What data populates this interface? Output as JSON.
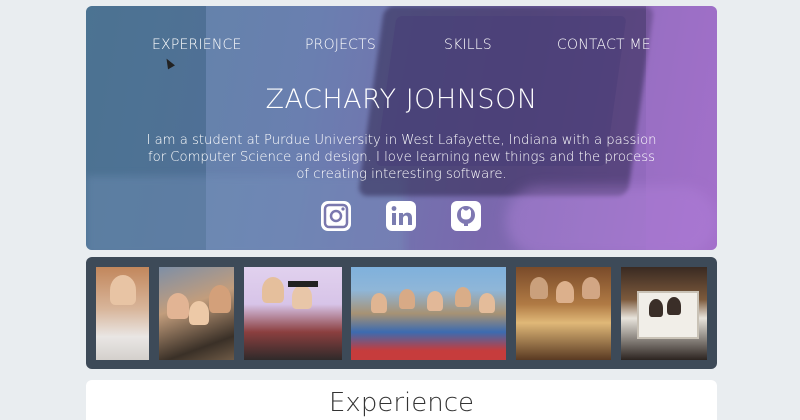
{
  "nav": {
    "experience": "EXPERIENCE",
    "projects": "PROJECTS",
    "skills": "SKILLS",
    "contact": "CONTACT ME"
  },
  "hero": {
    "name": "ZACHARY JOHNSON",
    "bio": "I am a student at Purdue University in West Lafayette, Indiana with a passion for Computer Science and design. I love learning new things and the process of creating interesting software."
  },
  "social": [
    {
      "icon": "instagram-icon"
    },
    {
      "icon": "linkedin-icon"
    },
    {
      "icon": "github-icon"
    }
  ],
  "gallery": {
    "photos": 6
  },
  "sections": {
    "experience_title": "Experience"
  },
  "colors": {
    "page_bg": "#e9edf0",
    "gallery_bg": "#3d4a58",
    "hero_gradient_start": "#5f86a6",
    "hero_gradient_end": "#a06cc7"
  }
}
